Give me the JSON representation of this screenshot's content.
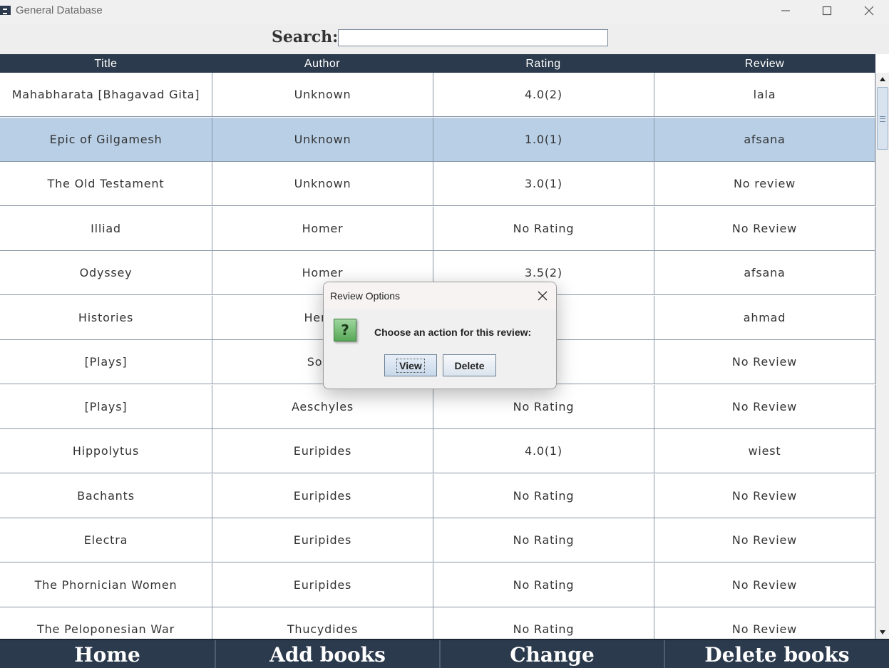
{
  "window": {
    "title": "General Database"
  },
  "search": {
    "label": "Search:",
    "value": "",
    "placeholder": ""
  },
  "table": {
    "columns": [
      "Title",
      "Author",
      "Rating",
      "Review"
    ],
    "rows": [
      [
        "Mahabharata [Bhagavad Gita]",
        "Unknown",
        "4.0(2)",
        "lala"
      ],
      [
        "Epic of Gilgamesh",
        "Unknown",
        "1.0(1)",
        "afsana"
      ],
      [
        "The Old Testament",
        "Unknown",
        "3.0(1)",
        "No review"
      ],
      [
        "Illiad",
        "Homer",
        "No Rating",
        "No Review"
      ],
      [
        "Odyssey",
        "Homer",
        "3.5(2)",
        "afsana"
      ],
      [
        "Histories",
        "Herod",
        ")",
        "ahmad"
      ],
      [
        "[Plays]",
        "Soph",
        "ng",
        "No Review"
      ],
      [
        "[Plays]",
        "Aeschyles",
        "No Rating",
        "No Review"
      ],
      [
        "Hippolytus",
        "Euripides",
        "4.0(1)",
        "wiest"
      ],
      [
        "Bachants",
        "Euripides",
        "No Rating",
        "No Review"
      ],
      [
        "Electra",
        "Euripides",
        "No Rating",
        "No Review"
      ],
      [
        "The Phornician Women",
        "Euripides",
        "No Rating",
        "No Review"
      ],
      [
        "The Peloponesian War",
        "Thucydides",
        "No Rating",
        "No Review"
      ]
    ],
    "selected_row": 1
  },
  "nav": {
    "home": "Home",
    "add_books": "Add books",
    "change": "Change",
    "delete_books": "Delete books"
  },
  "dialog": {
    "title": "Review Options",
    "message": "Choose an action for this review:",
    "icon": "question-icon",
    "view_label": "View",
    "delete_label": "Delete"
  },
  "colors": {
    "header_bg": "#2b3a4c",
    "selected_row": "#b8cfe6",
    "grid": "#8a97a6"
  }
}
